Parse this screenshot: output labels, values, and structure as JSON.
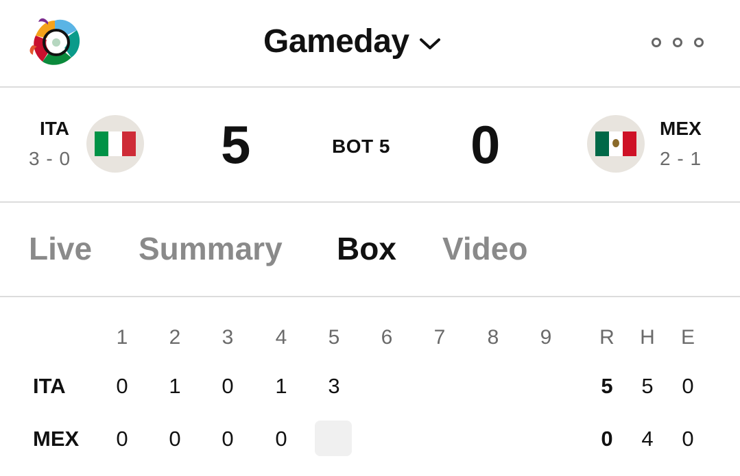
{
  "header": {
    "title": "Gameday",
    "logo_icon": "wbc-logo-icon",
    "dropdown_icon": "chevron-down-icon",
    "more_icon": "more-options-icon"
  },
  "game": {
    "away": {
      "abbr": "ITA",
      "record": "3 - 0",
      "score": "5",
      "flag_colors": [
        "#009246",
        "#ffffff",
        "#ce2b37"
      ]
    },
    "home": {
      "abbr": "MEX",
      "record": "2 - 1",
      "score": "0",
      "flag_colors": [
        "#006847",
        "#ffffff",
        "#ce1126"
      ]
    },
    "inning_status": "BOT 5"
  },
  "tabs": [
    {
      "label": "Live",
      "active": false
    },
    {
      "label": "Summary",
      "active": false
    },
    {
      "label": "Box",
      "active": true
    },
    {
      "label": "Video",
      "active": false
    }
  ],
  "linescore": {
    "innings": [
      "1",
      "2",
      "3",
      "4",
      "5",
      "6",
      "7",
      "8",
      "9"
    ],
    "totals_headers": [
      "R",
      "H",
      "E"
    ],
    "rows": [
      {
        "team": "ITA",
        "innings": [
          "0",
          "1",
          "0",
          "1",
          "3",
          "",
          "",
          "",
          ""
        ],
        "R": "5",
        "H": "5",
        "E": "0"
      },
      {
        "team": "MEX",
        "innings": [
          "0",
          "0",
          "0",
          "0",
          "",
          "",
          "",
          "",
          ""
        ],
        "R": "0",
        "H": "4",
        "E": "0"
      }
    ],
    "current_inning": "5"
  }
}
